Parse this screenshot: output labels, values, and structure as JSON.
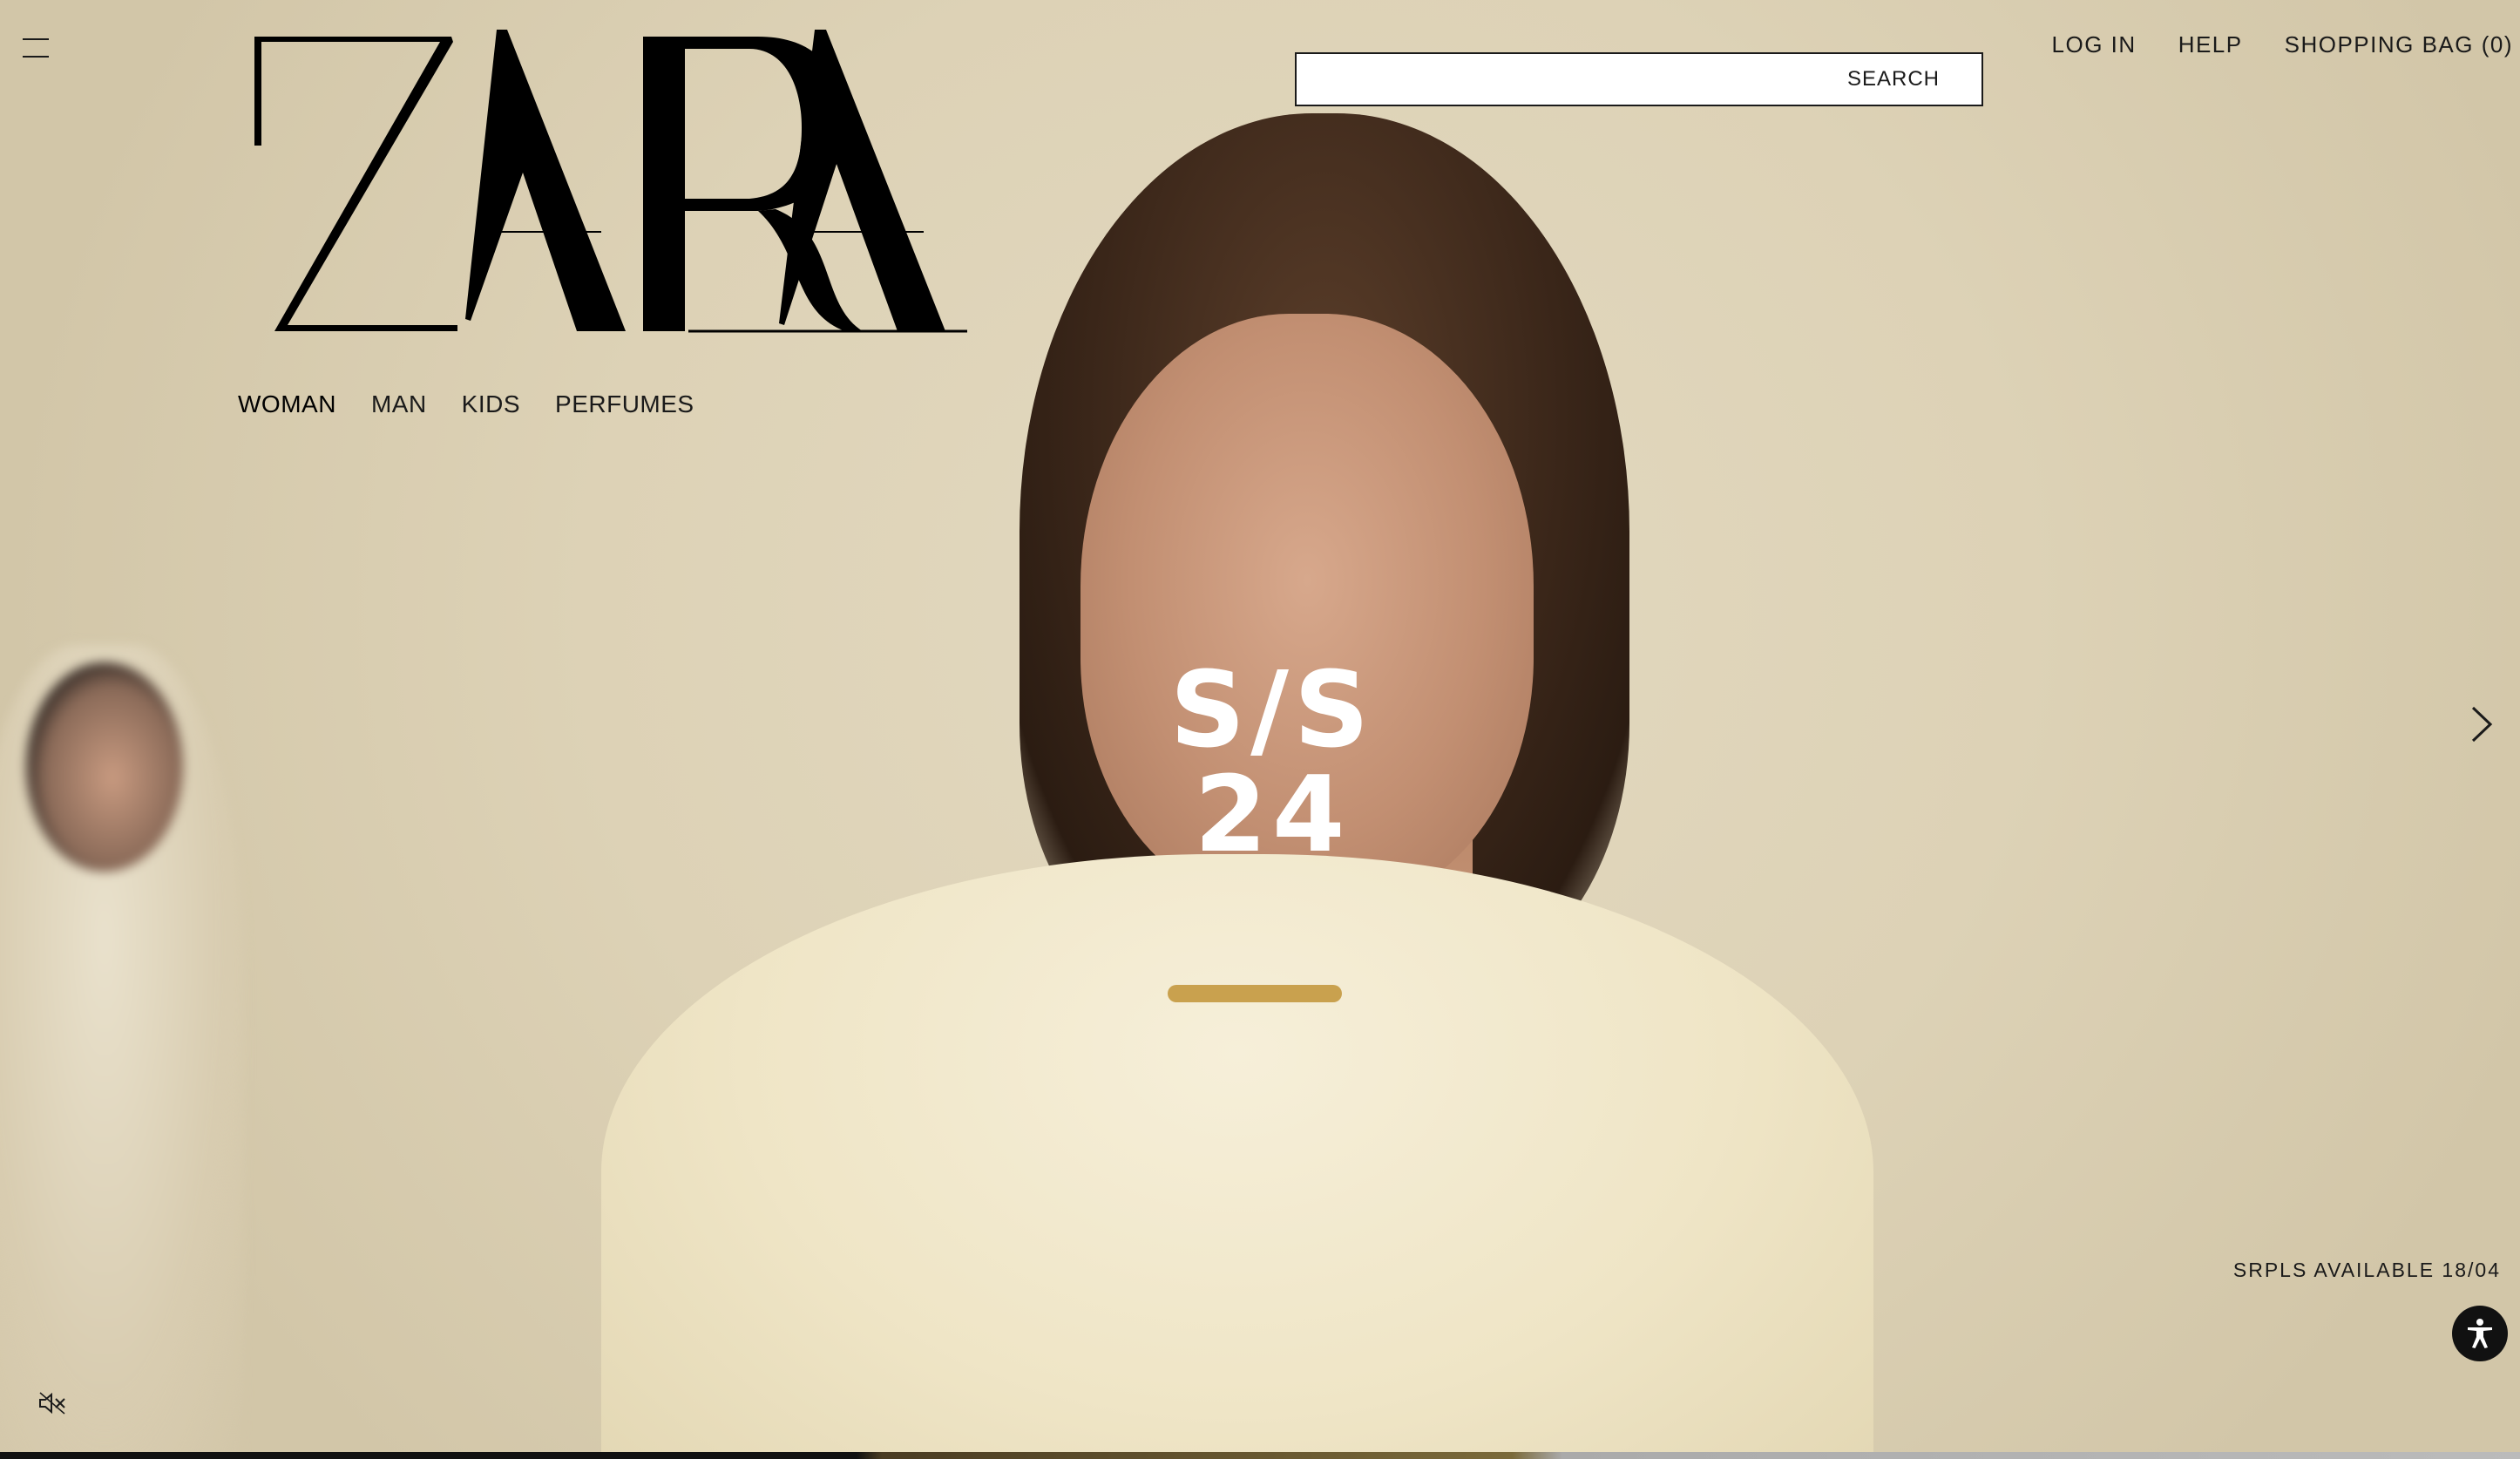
{
  "brand": {
    "logo_text": "ZARA"
  },
  "nav": {
    "items": [
      {
        "label": "WOMAN",
        "active": true
      },
      {
        "label": "MAN",
        "active": false
      },
      {
        "label": "KIDS",
        "active": false
      },
      {
        "label": "PERFUMES",
        "active": false
      }
    ]
  },
  "search": {
    "label": "SEARCH"
  },
  "header_links": {
    "login": "LOG IN",
    "help": "HELP",
    "bag": "SHOPPING BAG (0)"
  },
  "hero": {
    "title": "S/S 24",
    "promo": "SRPLS AVAILABLE 18/04"
  },
  "icons": {
    "menu": "menu-icon",
    "next": "chevron-right-icon",
    "accessibility": "accessibility-icon",
    "mute": "speaker-muted-icon"
  },
  "colors": {
    "background": "#ddd1b5",
    "text": "#1a1a1a",
    "title_text": "#ffffff"
  }
}
